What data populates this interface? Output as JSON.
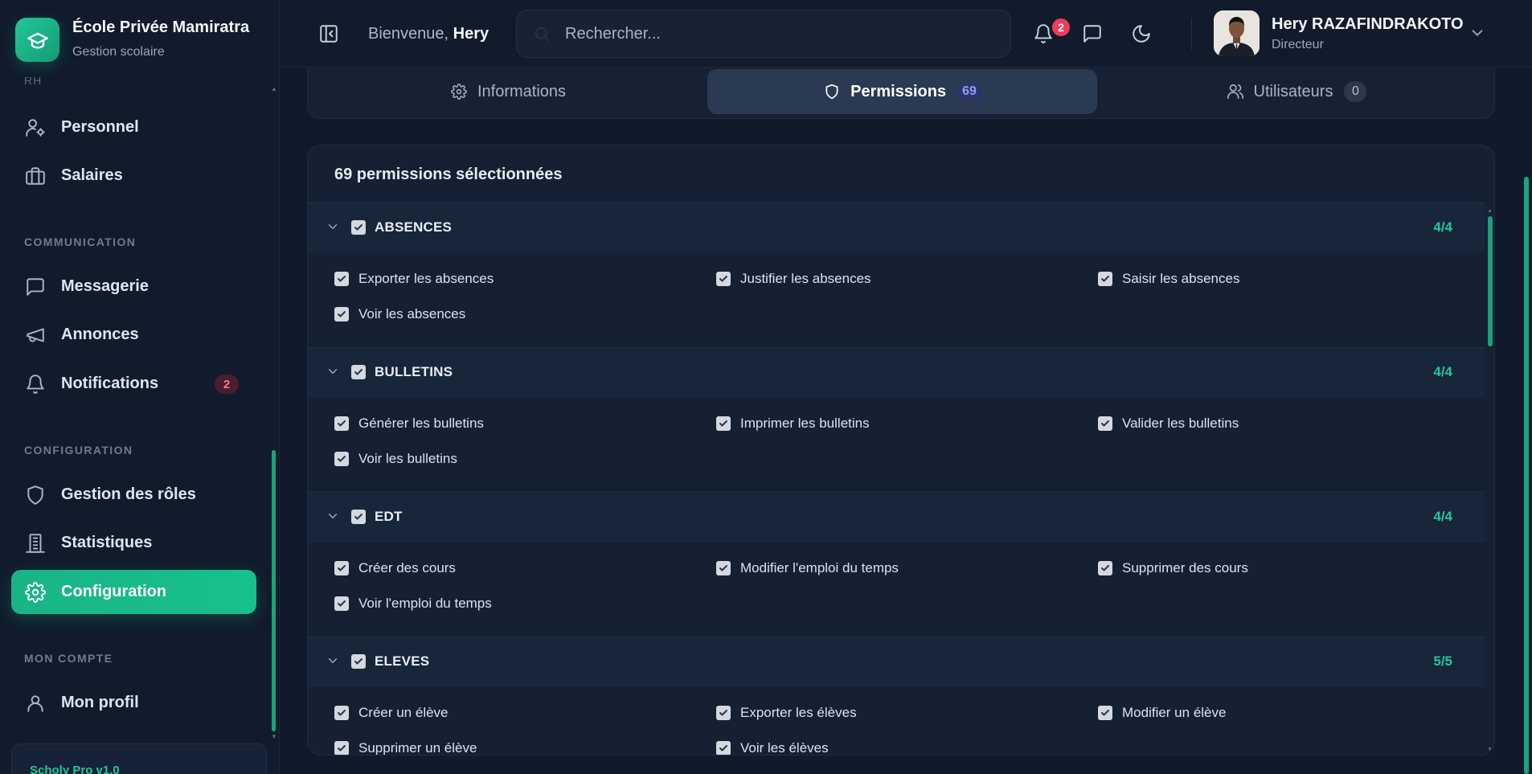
{
  "brand": {
    "name": "École Privée Mamiratra",
    "subtitle": "Gestion scolaire"
  },
  "sidebar": {
    "clipped_label": "RH",
    "items_top": [
      {
        "label": "Personnel",
        "icon": "user-cog-icon"
      },
      {
        "label": "Salaires",
        "icon": "briefcase-icon"
      }
    ],
    "sections": {
      "communication": "COMMUNICATION",
      "configuration": "CONFIGURATION",
      "account": "MON COMPTE"
    },
    "communication_items": [
      {
        "label": "Messagerie",
        "icon": "message-icon"
      },
      {
        "label": "Annonces",
        "icon": "megaphone-icon"
      },
      {
        "label": "Notifications",
        "icon": "bell-icon",
        "badge": "2"
      }
    ],
    "configuration_items": [
      {
        "label": "Gestion des rôles",
        "icon": "shield-icon"
      },
      {
        "label": "Statistiques",
        "icon": "chart-icon"
      },
      {
        "label": "Configuration",
        "icon": "gear-icon",
        "active": true
      }
    ],
    "account_items": [
      {
        "label": "Mon profil",
        "icon": "user-icon"
      }
    ],
    "version": "Scholy Pro v1.0"
  },
  "topbar": {
    "welcome_prefix": "Bienvenue,",
    "welcome_name": "Hery",
    "search_placeholder": "Rechercher...",
    "notification_count": "2",
    "user_name": "Hery RAZAFINDRAKOTO",
    "user_role": "Directeur"
  },
  "tabs": [
    {
      "label": "Informations",
      "icon": "gear-icon"
    },
    {
      "label": "Permissions",
      "icon": "shield-icon",
      "count": "69",
      "active": true
    },
    {
      "label": "Utilisateurs",
      "icon": "users-icon",
      "count": "0"
    }
  ],
  "panel": {
    "title": "69 permissions sélectionnées",
    "groups": [
      {
        "name": "ABSENCES",
        "count": "4/4",
        "rows": [
          [
            "Exporter les absences",
            "Justifier les absences",
            "Saisir les absences"
          ],
          [
            "Voir les absences"
          ]
        ]
      },
      {
        "name": "BULLETINS",
        "count": "4/4",
        "rows": [
          [
            "Générer les bulletins",
            "Imprimer les bulletins",
            "Valider les bulletins"
          ],
          [
            "Voir les bulletins"
          ]
        ]
      },
      {
        "name": "EDT",
        "count": "4/4",
        "rows": [
          [
            "Créer des cours",
            "Modifier l'emploi du temps",
            "Supprimer des cours"
          ],
          [
            "Voir l'emploi du temps"
          ]
        ]
      },
      {
        "name": "ELEVES",
        "count": "5/5",
        "rows": [
          [
            "Créer un élève",
            "Exporter les élèves",
            "Modifier un élève"
          ],
          [
            "Supprimer un élève",
            "Voir les élèves"
          ]
        ]
      }
    ]
  },
  "colors": {
    "accent": "#19b486",
    "background": "#111a2b",
    "panel": "#152032",
    "badge_red": "#ef3b5b",
    "count_purple": "#8f9cff"
  }
}
